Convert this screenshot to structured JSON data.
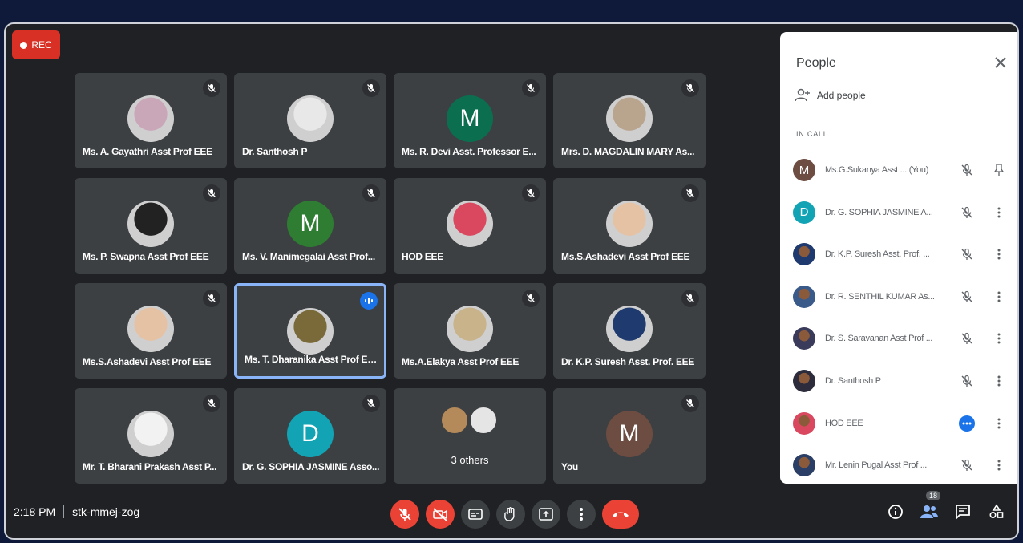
{
  "rec_label": "REC",
  "tiles": [
    {
      "name": "Ms. A. Gayathri Asst Prof EEE",
      "avatar": "photo",
      "color": "#c9a7b8"
    },
    {
      "name": "Dr. Santhosh P",
      "avatar": "photo",
      "color": "#e8e8e8"
    },
    {
      "name": "Ms. R. Devi Asst. Professor E...",
      "avatar": "M",
      "color": "#0b6e4f"
    },
    {
      "name": "Mrs. D. MAGDALIN MARY As...",
      "avatar": "photo",
      "color": "#b9a48e"
    },
    {
      "name": "Ms. P. Swapna Asst Prof EEE",
      "avatar": "photo",
      "color": "#222"
    },
    {
      "name": "Ms. V. Manimegalai Asst Prof...",
      "avatar": "M",
      "color": "#2e7d32"
    },
    {
      "name": "HOD EEE",
      "avatar": "photo",
      "color": "#d9485f"
    },
    {
      "name": "Ms.S.Ashadevi Asst Prof EEE",
      "avatar": "photo",
      "color": "#e6c2a4"
    },
    {
      "name": "Ms.S.Ashadevi Asst Prof EEE",
      "avatar": "photo",
      "color": "#e6c2a4"
    },
    {
      "name": "Ms. T. Dharanika Asst Prof EEE",
      "avatar": "photo",
      "color": "#7a6a3a"
    },
    {
      "name": "Ms.A.Elakya Asst Prof EEE",
      "avatar": "photo",
      "color": "#c9b38a"
    },
    {
      "name": "Dr. K.P. Suresh Asst. Prof. EEE",
      "avatar": "photo",
      "color": "#1f3a6e"
    },
    {
      "name": "Mr. T. Bharani Prakash Asst P...",
      "avatar": "photo",
      "color": "#f2f2f2"
    },
    {
      "name": "Dr. G. SOPHIA JASMINE Asso...",
      "avatar": "D",
      "color": "#12a4b4"
    },
    {
      "name": "",
      "avatar": "others",
      "color": "#3c4043"
    },
    {
      "name": "You",
      "avatar": "M",
      "color": "#6d4c41"
    }
  ],
  "others_label": "3 others",
  "people": {
    "title": "People",
    "add_label": "Add people",
    "in_call_label": "IN CALL",
    "list": [
      {
        "name": "Ms.G.Sukanya Asst ...",
        "suffix": "(You)",
        "initial": "M",
        "color": "#6d4c41",
        "action": "pin"
      },
      {
        "name": "Dr. G. SOPHIA JASMINE A...",
        "suffix": "",
        "initial": "D",
        "color": "#12a4b4",
        "action": "more"
      },
      {
        "name": "Dr. K.P. Suresh Asst. Prof. ...",
        "suffix": "",
        "initial": "",
        "color": "#1f3a6e",
        "action": "more"
      },
      {
        "name": "Dr. R. SENTHIL KUMAR As...",
        "suffix": "",
        "initial": "",
        "color": "#3a5a8a",
        "action": "more"
      },
      {
        "name": "Dr. S. Saravanan Asst Prof ...",
        "suffix": "",
        "initial": "",
        "color": "#3a3a5a",
        "action": "more"
      },
      {
        "name": "Dr. Santhosh P",
        "suffix": "",
        "initial": "",
        "color": "#2c2c3c",
        "action": "more"
      },
      {
        "name": "HOD EEE",
        "suffix": "",
        "initial": "",
        "color": "#d9485f",
        "action": "more",
        "speaking": true
      },
      {
        "name": "Mr. Lenin Pugal Asst Prof ...",
        "suffix": "",
        "initial": "",
        "color": "#2b3f66",
        "action": "more"
      }
    ]
  },
  "time": "2:18 PM",
  "meeting_code": "stk-mmej-zog",
  "participant_count": "18",
  "colors": {
    "end_call": "#ea4335",
    "panel": "#ffffff",
    "tile": "#3c4043",
    "accent": "#1a73e8"
  }
}
